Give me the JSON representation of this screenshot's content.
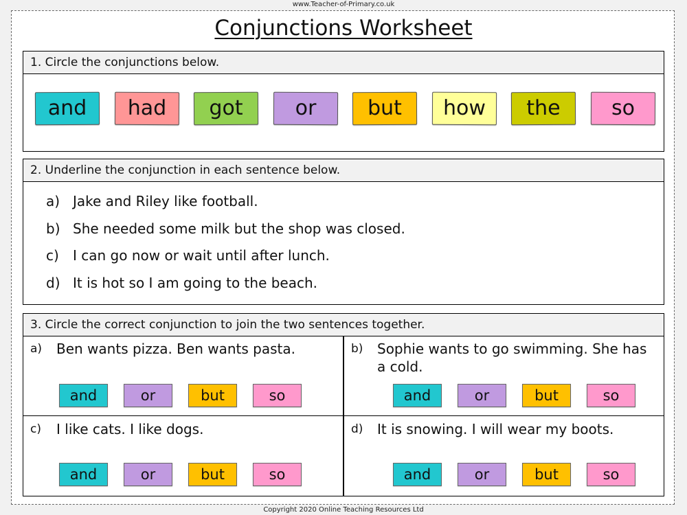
{
  "site_url": "www.Teacher-of-Primary.co.uk",
  "title": "Conjunctions Worksheet",
  "copyright": "Copyright 2020 Online Teaching Resources Ltd",
  "section1": {
    "instruction": "1.  Circle the conjunctions below.",
    "words": [
      {
        "text": "and",
        "color": "#22c7cf"
      },
      {
        "text": "had",
        "color": "#ff9696"
      },
      {
        "text": "got",
        "color": "#92d050"
      },
      {
        "text": "or",
        "color": "#c09ae0"
      },
      {
        "text": "but",
        "color": "#ffc000"
      },
      {
        "text": "how",
        "color": "#ffff99"
      },
      {
        "text": "the",
        "color": "#cccc00"
      },
      {
        "text": "so",
        "color": "#ff99cc"
      }
    ]
  },
  "section2": {
    "instruction": "2. Underline the conjunction in each sentence below.",
    "sentences": [
      {
        "label": "a)",
        "text": "Jake and Riley like football."
      },
      {
        "label": "b)",
        "text": "She needed some milk but the shop was closed."
      },
      {
        "label": "c)",
        "text": "I can go now or wait until after lunch."
      },
      {
        "label": "d)",
        "text": "It is hot so I am going to the beach."
      }
    ]
  },
  "section3": {
    "instruction": "3.   Circle the correct conjunction to join the two sentences together.",
    "choices": [
      {
        "text": "and",
        "color": "#22c7cf"
      },
      {
        "text": "or",
        "color": "#c09ae0"
      },
      {
        "text": "but",
        "color": "#ffc000"
      },
      {
        "text": "so",
        "color": "#ff99cc"
      }
    ],
    "questions": [
      {
        "label": "a)",
        "text": "Ben wants pizza. Ben wants pasta."
      },
      {
        "label": "b)",
        "text": "Sophie wants to go swimming. She has a cold."
      },
      {
        "label": "c)",
        "text": "I like cats. I like dogs."
      },
      {
        "label": "d)",
        "text": "It is snowing. I will wear my boots."
      }
    ]
  }
}
